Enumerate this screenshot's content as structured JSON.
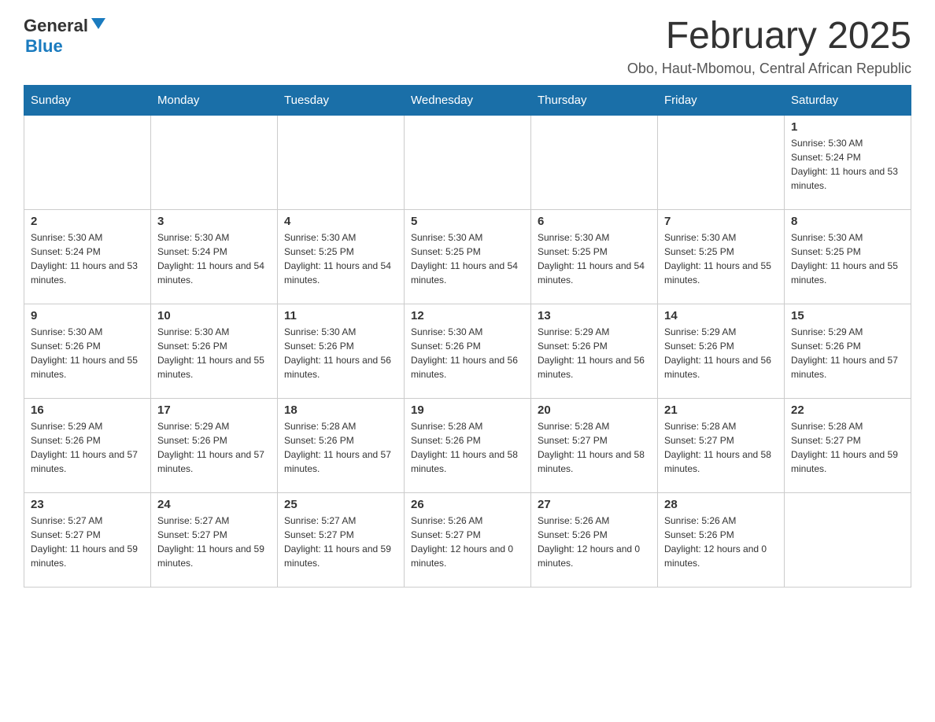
{
  "header": {
    "logo_general": "General",
    "logo_blue": "Blue",
    "month_title": "February 2025",
    "location": "Obo, Haut-Mbomou, Central African Republic"
  },
  "days_of_week": [
    "Sunday",
    "Monday",
    "Tuesday",
    "Wednesday",
    "Thursday",
    "Friday",
    "Saturday"
  ],
  "weeks": [
    [
      {
        "day": "",
        "sunrise": "",
        "sunset": "",
        "daylight": ""
      },
      {
        "day": "",
        "sunrise": "",
        "sunset": "",
        "daylight": ""
      },
      {
        "day": "",
        "sunrise": "",
        "sunset": "",
        "daylight": ""
      },
      {
        "day": "",
        "sunrise": "",
        "sunset": "",
        "daylight": ""
      },
      {
        "day": "",
        "sunrise": "",
        "sunset": "",
        "daylight": ""
      },
      {
        "day": "",
        "sunrise": "",
        "sunset": "",
        "daylight": ""
      },
      {
        "day": "1",
        "sunrise": "Sunrise: 5:30 AM",
        "sunset": "Sunset: 5:24 PM",
        "daylight": "Daylight: 11 hours and 53 minutes."
      }
    ],
    [
      {
        "day": "2",
        "sunrise": "Sunrise: 5:30 AM",
        "sunset": "Sunset: 5:24 PM",
        "daylight": "Daylight: 11 hours and 53 minutes."
      },
      {
        "day": "3",
        "sunrise": "Sunrise: 5:30 AM",
        "sunset": "Sunset: 5:24 PM",
        "daylight": "Daylight: 11 hours and 54 minutes."
      },
      {
        "day": "4",
        "sunrise": "Sunrise: 5:30 AM",
        "sunset": "Sunset: 5:25 PM",
        "daylight": "Daylight: 11 hours and 54 minutes."
      },
      {
        "day": "5",
        "sunrise": "Sunrise: 5:30 AM",
        "sunset": "Sunset: 5:25 PM",
        "daylight": "Daylight: 11 hours and 54 minutes."
      },
      {
        "day": "6",
        "sunrise": "Sunrise: 5:30 AM",
        "sunset": "Sunset: 5:25 PM",
        "daylight": "Daylight: 11 hours and 54 minutes."
      },
      {
        "day": "7",
        "sunrise": "Sunrise: 5:30 AM",
        "sunset": "Sunset: 5:25 PM",
        "daylight": "Daylight: 11 hours and 55 minutes."
      },
      {
        "day": "8",
        "sunrise": "Sunrise: 5:30 AM",
        "sunset": "Sunset: 5:25 PM",
        "daylight": "Daylight: 11 hours and 55 minutes."
      }
    ],
    [
      {
        "day": "9",
        "sunrise": "Sunrise: 5:30 AM",
        "sunset": "Sunset: 5:26 PM",
        "daylight": "Daylight: 11 hours and 55 minutes."
      },
      {
        "day": "10",
        "sunrise": "Sunrise: 5:30 AM",
        "sunset": "Sunset: 5:26 PM",
        "daylight": "Daylight: 11 hours and 55 minutes."
      },
      {
        "day": "11",
        "sunrise": "Sunrise: 5:30 AM",
        "sunset": "Sunset: 5:26 PM",
        "daylight": "Daylight: 11 hours and 56 minutes."
      },
      {
        "day": "12",
        "sunrise": "Sunrise: 5:30 AM",
        "sunset": "Sunset: 5:26 PM",
        "daylight": "Daylight: 11 hours and 56 minutes."
      },
      {
        "day": "13",
        "sunrise": "Sunrise: 5:29 AM",
        "sunset": "Sunset: 5:26 PM",
        "daylight": "Daylight: 11 hours and 56 minutes."
      },
      {
        "day": "14",
        "sunrise": "Sunrise: 5:29 AM",
        "sunset": "Sunset: 5:26 PM",
        "daylight": "Daylight: 11 hours and 56 minutes."
      },
      {
        "day": "15",
        "sunrise": "Sunrise: 5:29 AM",
        "sunset": "Sunset: 5:26 PM",
        "daylight": "Daylight: 11 hours and 57 minutes."
      }
    ],
    [
      {
        "day": "16",
        "sunrise": "Sunrise: 5:29 AM",
        "sunset": "Sunset: 5:26 PM",
        "daylight": "Daylight: 11 hours and 57 minutes."
      },
      {
        "day": "17",
        "sunrise": "Sunrise: 5:29 AM",
        "sunset": "Sunset: 5:26 PM",
        "daylight": "Daylight: 11 hours and 57 minutes."
      },
      {
        "day": "18",
        "sunrise": "Sunrise: 5:28 AM",
        "sunset": "Sunset: 5:26 PM",
        "daylight": "Daylight: 11 hours and 57 minutes."
      },
      {
        "day": "19",
        "sunrise": "Sunrise: 5:28 AM",
        "sunset": "Sunset: 5:26 PM",
        "daylight": "Daylight: 11 hours and 58 minutes."
      },
      {
        "day": "20",
        "sunrise": "Sunrise: 5:28 AM",
        "sunset": "Sunset: 5:27 PM",
        "daylight": "Daylight: 11 hours and 58 minutes."
      },
      {
        "day": "21",
        "sunrise": "Sunrise: 5:28 AM",
        "sunset": "Sunset: 5:27 PM",
        "daylight": "Daylight: 11 hours and 58 minutes."
      },
      {
        "day": "22",
        "sunrise": "Sunrise: 5:28 AM",
        "sunset": "Sunset: 5:27 PM",
        "daylight": "Daylight: 11 hours and 59 minutes."
      }
    ],
    [
      {
        "day": "23",
        "sunrise": "Sunrise: 5:27 AM",
        "sunset": "Sunset: 5:27 PM",
        "daylight": "Daylight: 11 hours and 59 minutes."
      },
      {
        "day": "24",
        "sunrise": "Sunrise: 5:27 AM",
        "sunset": "Sunset: 5:27 PM",
        "daylight": "Daylight: 11 hours and 59 minutes."
      },
      {
        "day": "25",
        "sunrise": "Sunrise: 5:27 AM",
        "sunset": "Sunset: 5:27 PM",
        "daylight": "Daylight: 11 hours and 59 minutes."
      },
      {
        "day": "26",
        "sunrise": "Sunrise: 5:26 AM",
        "sunset": "Sunset: 5:27 PM",
        "daylight": "Daylight: 12 hours and 0 minutes."
      },
      {
        "day": "27",
        "sunrise": "Sunrise: 5:26 AM",
        "sunset": "Sunset: 5:26 PM",
        "daylight": "Daylight: 12 hours and 0 minutes."
      },
      {
        "day": "28",
        "sunrise": "Sunrise: 5:26 AM",
        "sunset": "Sunset: 5:26 PM",
        "daylight": "Daylight: 12 hours and 0 minutes."
      },
      {
        "day": "",
        "sunrise": "",
        "sunset": "",
        "daylight": ""
      }
    ]
  ]
}
